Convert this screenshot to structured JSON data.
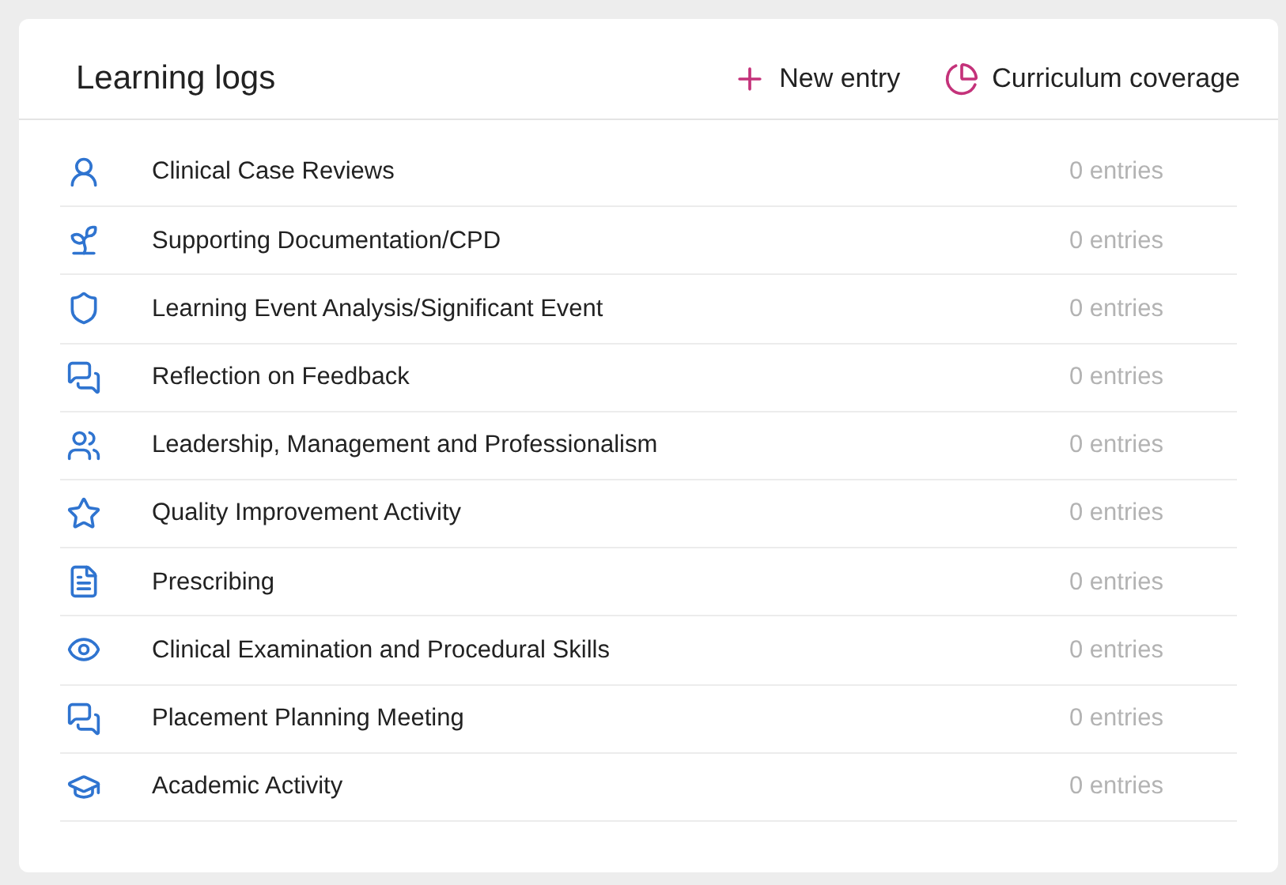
{
  "card": {
    "title": "Learning logs",
    "actions": [
      {
        "kind": "add",
        "label": "New entry"
      },
      {
        "kind": "coverage",
        "label": "Curriculum coverage"
      }
    ]
  },
  "logs": [
    {
      "kind": "person",
      "name": "Clinical Case Reviews",
      "count": "0 entries"
    },
    {
      "kind": "sprout",
      "name": "Supporting Documentation/CPD",
      "count": "0 entries"
    },
    {
      "kind": "shield",
      "name": "Learning Event Analysis/Significant Event",
      "count": "0 entries"
    },
    {
      "kind": "chat",
      "name": "Reflection on Feedback",
      "count": "0 entries"
    },
    {
      "kind": "group",
      "name": "Leadership, Management and Professionalism",
      "count": "0 entries"
    },
    {
      "kind": "star",
      "name": "Quality Improvement Activity",
      "count": "0 entries"
    },
    {
      "kind": "document",
      "name": "Prescribing",
      "count": "0 entries"
    },
    {
      "kind": "eye",
      "name": "Clinical Examination and Procedural Skills",
      "count": "0 entries"
    },
    {
      "kind": "chat",
      "name": "Placement Planning Meeting",
      "count": "0 entries"
    },
    {
      "kind": "cap",
      "name": "Academic Activity",
      "count": "0 entries"
    }
  ]
}
